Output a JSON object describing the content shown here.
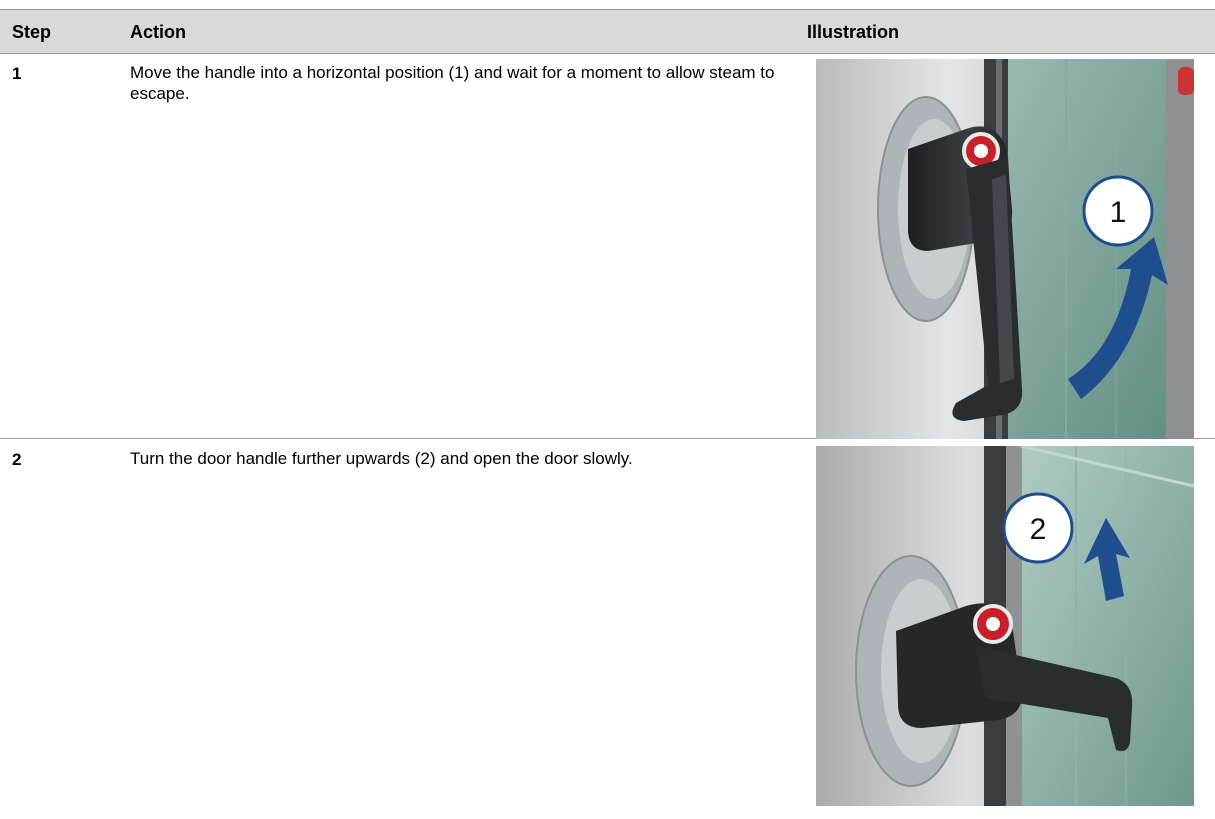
{
  "table": {
    "headers": {
      "step": "Step",
      "action": "Action",
      "illustration": "Illustration"
    },
    "rows": [
      {
        "step": "1",
        "action": "Move the handle into a horizontal position (1) and wait for a moment to allow steam to escape.",
        "callout": "1"
      },
      {
        "step": "2",
        "action": "Turn the door handle further upwards (2) and open the door slowly.",
        "callout": "2"
      }
    ]
  },
  "colors": {
    "header_bg": "#d9d9d9",
    "arrow": "#1f4e8f",
    "glass": "#7fa89f",
    "handle": "#2a2d30",
    "steel": "#c9cbcc"
  }
}
